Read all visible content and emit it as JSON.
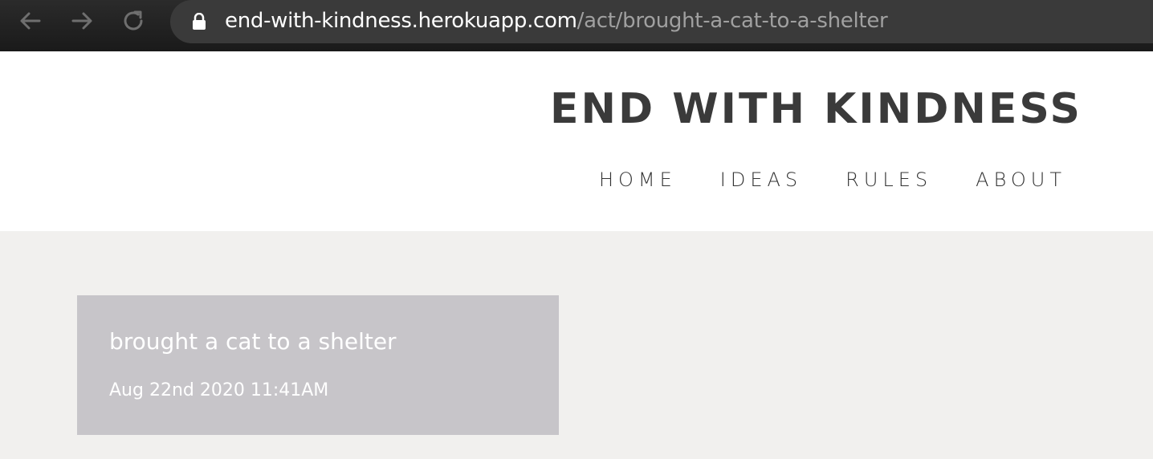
{
  "browser": {
    "url_host": "end-with-kindness.herokuapp.com",
    "url_path": "/act/brought-a-cat-to-a-shelter",
    "icons": [
      "back-arrow-icon",
      "forward-arrow-icon",
      "reload-icon",
      "lock-icon"
    ]
  },
  "header": {
    "site_title": "END WITH KINDNESS",
    "nav": {
      "home": "HOME",
      "ideas": "IDEAS",
      "rules": "RULES",
      "about": "ABOUT"
    }
  },
  "act": {
    "title": "brought a cat to a shelter",
    "date": "Aug 22nd 2020 11:41AM"
  },
  "colors": {
    "page_background": "#f1f0ee",
    "header_background": "#ffffff",
    "card_background": "#c7c5c9",
    "title_text": "#3a3a3a",
    "browser_bar": "#1f1f1f"
  }
}
